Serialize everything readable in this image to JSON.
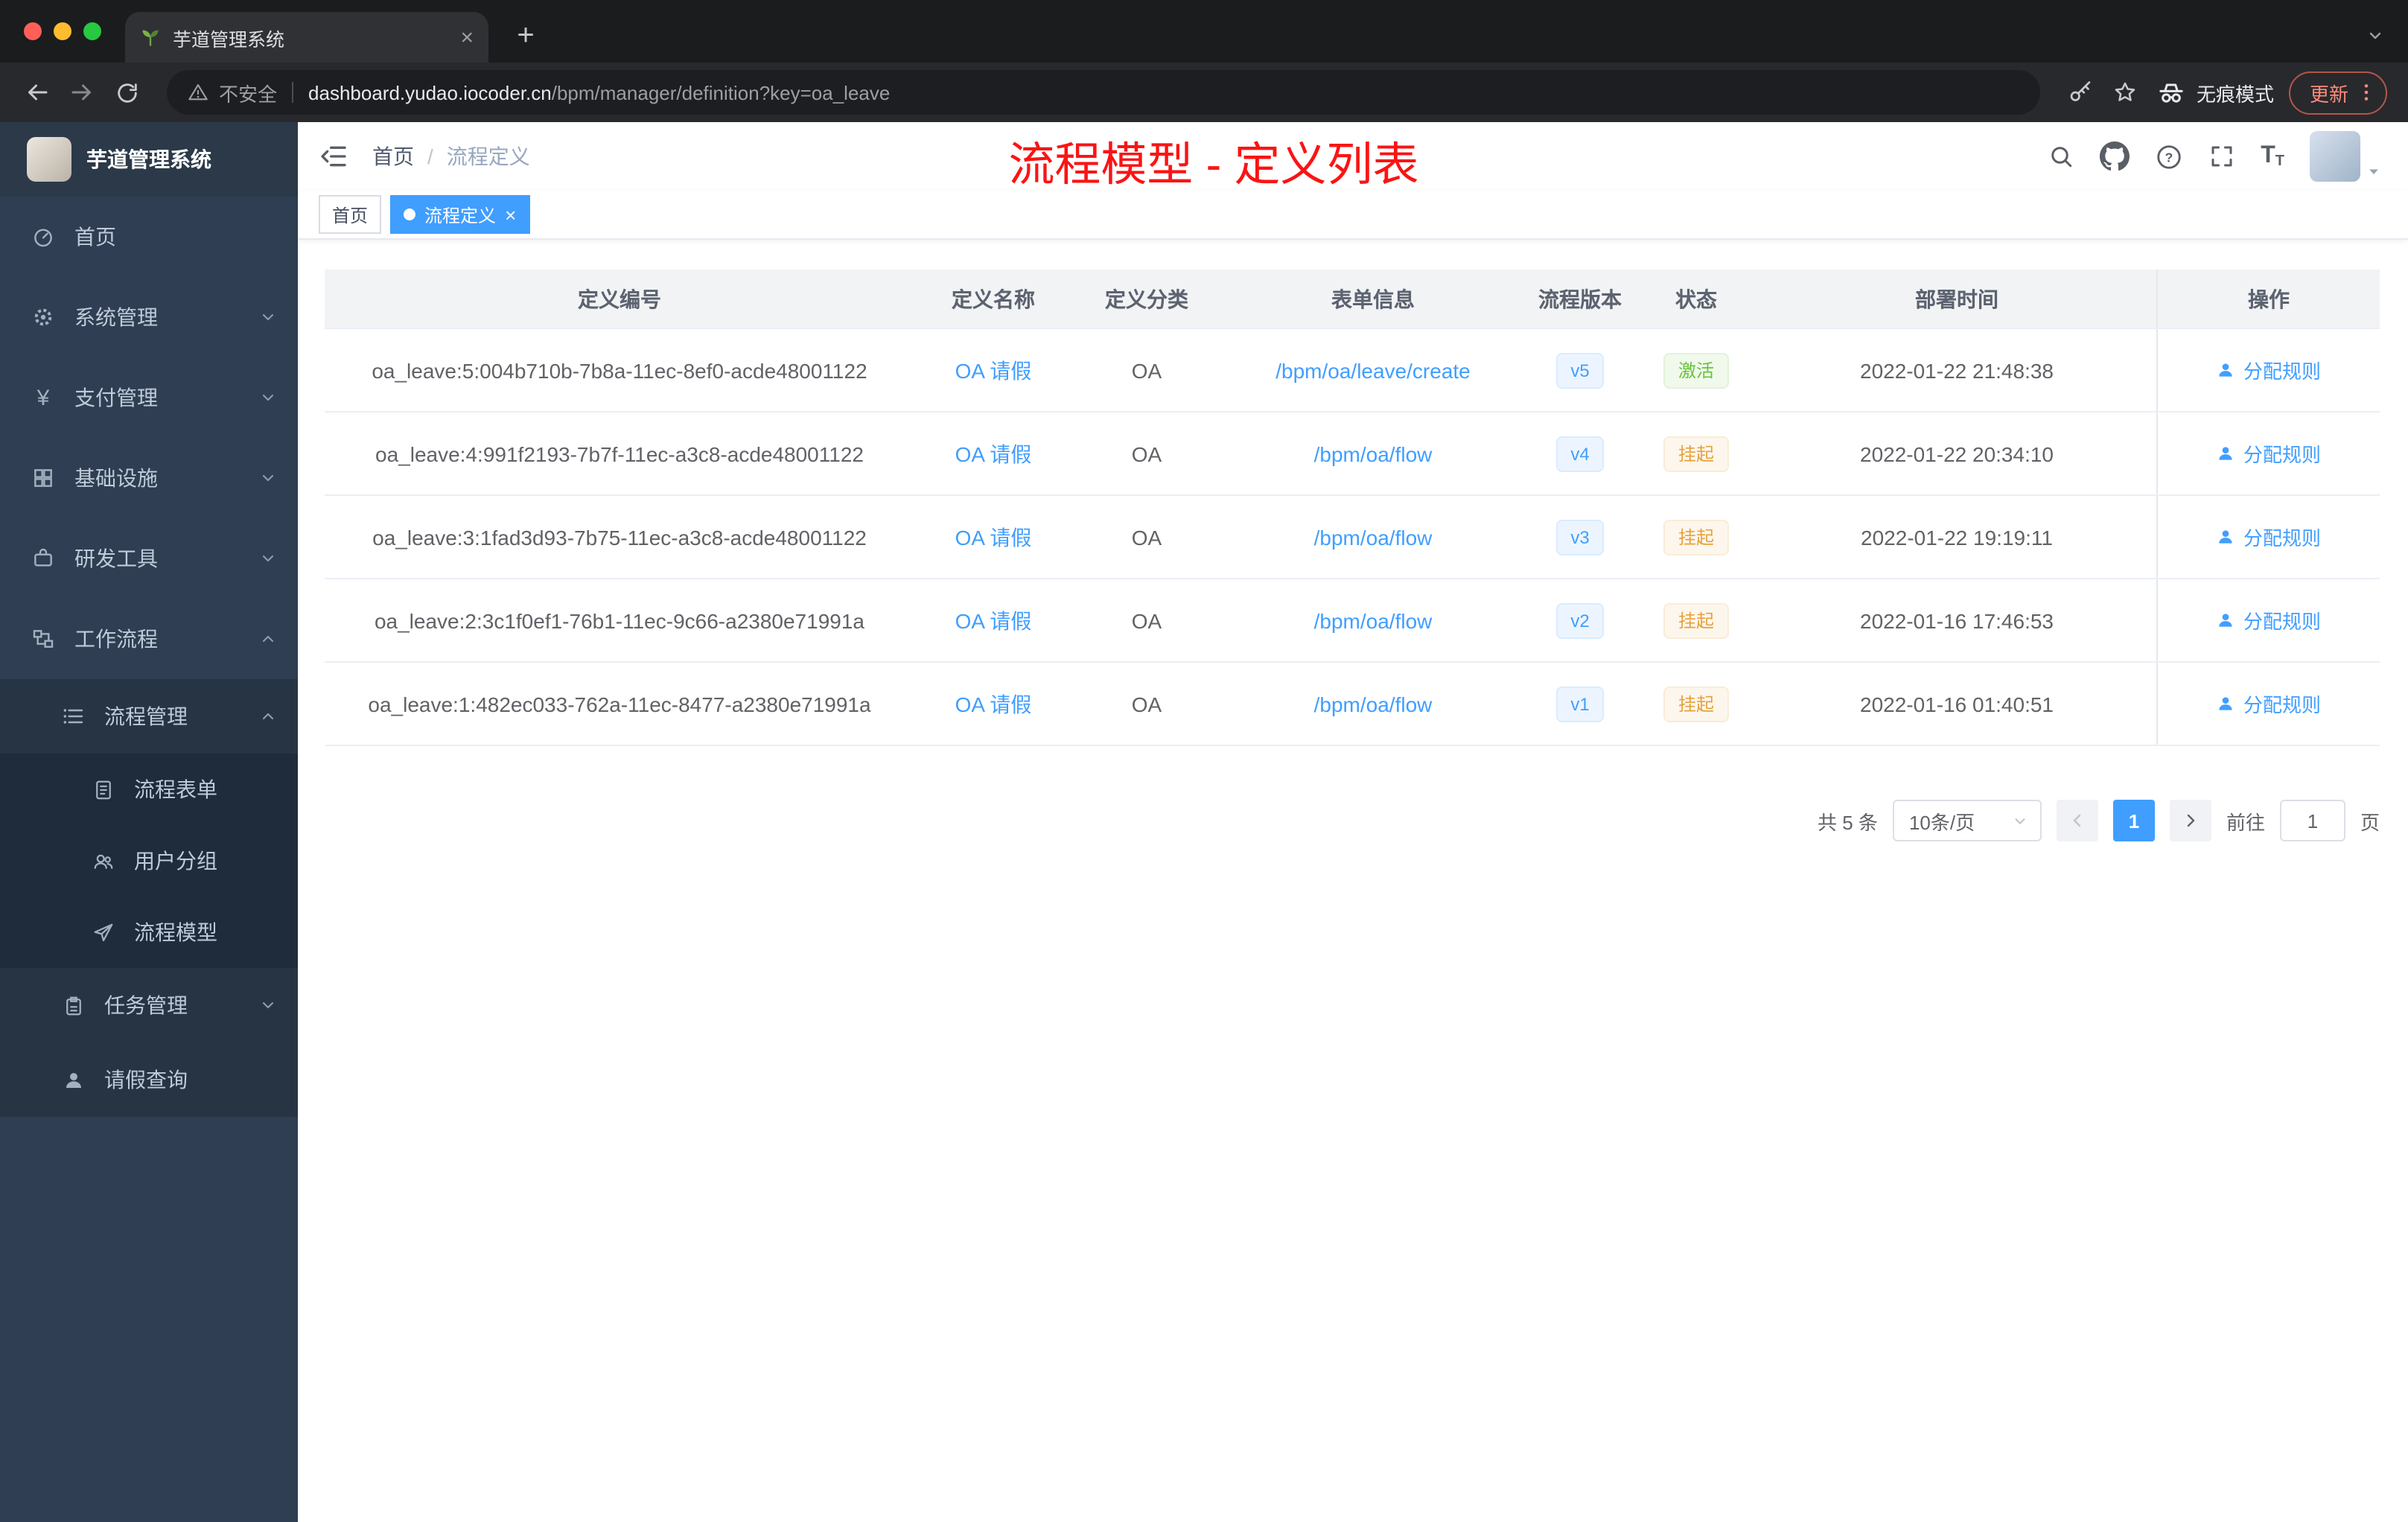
{
  "browser": {
    "tab_title": "芋道管理系统",
    "security_label": "不安全",
    "url_domain": "dashboard.yudao.iocoder.cn",
    "url_path": "/bpm/manager/definition?key=oa_leave",
    "incognito_label": "无痕模式",
    "update_label": "更新"
  },
  "sidebar": {
    "logo_title": "芋道管理系统",
    "items": [
      {
        "label": "首页"
      },
      {
        "label": "系统管理"
      },
      {
        "label": "支付管理"
      },
      {
        "label": "基础设施"
      },
      {
        "label": "研发工具"
      },
      {
        "label": "工作流程"
      },
      {
        "label": "流程管理"
      },
      {
        "label": "流程表单"
      },
      {
        "label": "用户分组"
      },
      {
        "label": "流程模型"
      },
      {
        "label": "任务管理"
      },
      {
        "label": "请假查询"
      }
    ]
  },
  "header": {
    "breadcrumb": {
      "home": "首页",
      "separator": "/",
      "current": "流程定义"
    },
    "annotation": "流程模型 - 定义列表"
  },
  "tags": {
    "home": "首页",
    "active": "流程定义"
  },
  "table": {
    "columns": [
      "定义编号",
      "定义名称",
      "定义分类",
      "表单信息",
      "流程版本",
      "状态",
      "部署时间",
      "操作"
    ],
    "rows": [
      {
        "id": "oa_leave:5:004b710b-7b8a-11ec-8ef0-acde48001122",
        "name": "OA 请假",
        "category": "OA",
        "form": "/bpm/oa/leave/create",
        "version": "v5",
        "status": "激活",
        "time": "2022-01-22 21:48:38",
        "action": "分配规则"
      },
      {
        "id": "oa_leave:4:991f2193-7b7f-11ec-a3c8-acde48001122",
        "name": "OA 请假",
        "category": "OA",
        "form": "/bpm/oa/flow",
        "version": "v4",
        "status": "挂起",
        "time": "2022-01-22 20:34:10",
        "action": "分配规则"
      },
      {
        "id": "oa_leave:3:1fad3d93-7b75-11ec-a3c8-acde48001122",
        "name": "OA 请假",
        "category": "OA",
        "form": "/bpm/oa/flow",
        "version": "v3",
        "status": "挂起",
        "time": "2022-01-22 19:19:11",
        "action": "分配规则"
      },
      {
        "id": "oa_leave:2:3c1f0ef1-76b1-11ec-9c66-a2380e71991a",
        "name": "OA 请假",
        "category": "OA",
        "form": "/bpm/oa/flow",
        "version": "v2",
        "status": "挂起",
        "time": "2022-01-16 17:46:53",
        "action": "分配规则"
      },
      {
        "id": "oa_leave:1:482ec033-762a-11ec-8477-a2380e71991a",
        "name": "OA 请假",
        "category": "OA",
        "form": "/bpm/oa/flow",
        "version": "v1",
        "status": "挂起",
        "time": "2022-01-16 01:40:51",
        "action": "分配规则"
      }
    ]
  },
  "pagination": {
    "total": "共 5 条",
    "page_size": "10条/页",
    "current_page": "1",
    "goto_label": "前往",
    "goto_value": "1",
    "page_unit": "页"
  },
  "colors": {
    "accent": "#409eff",
    "success": "#67c23a",
    "warning": "#e6a23c",
    "annotation_red": "#fa1414",
    "sidebar_bg": "#2f3e52"
  }
}
